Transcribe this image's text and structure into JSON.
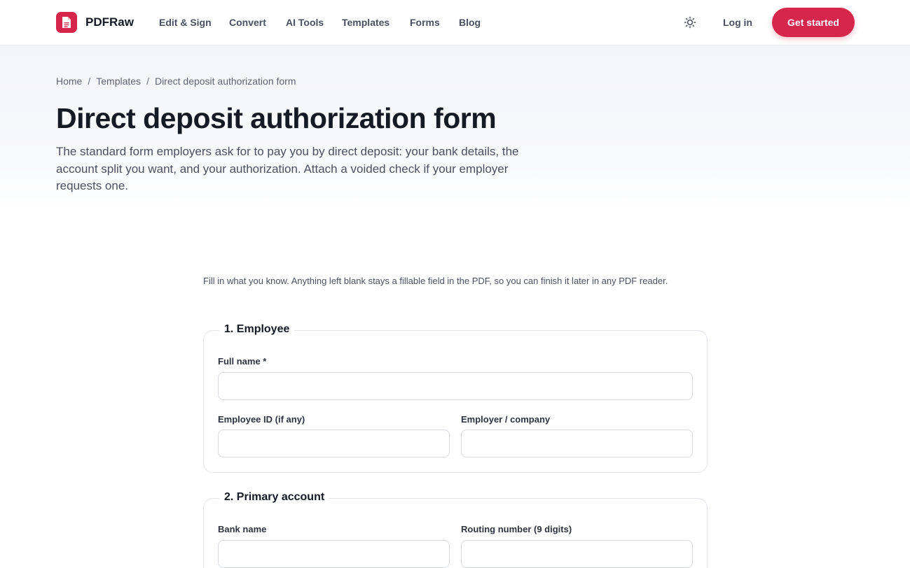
{
  "header": {
    "brand": "PDFRaw",
    "nav": [
      "Edit & Sign",
      "Convert",
      "AI Tools",
      "Templates",
      "Forms",
      "Blog"
    ],
    "login_label": "Log in",
    "cta_label": "Get started",
    "theme_icon": "sun-icon",
    "logo_icon": "document-icon"
  },
  "breadcrumb": {
    "items": [
      "Home",
      "Templates",
      "Direct deposit authorization form"
    ],
    "separator": "/"
  },
  "page": {
    "title": "Direct deposit authorization form",
    "lede": "The standard form employers ask for to pay you by direct deposit: your bank details, the account split you want, and your authorization. Attach a voided check if your employer requests one."
  },
  "form": {
    "intro": "Fill in what you know. Anything left blank stays a fillable field in the PDF, so you can finish it later in any PDF reader.",
    "sections": [
      {
        "legend": "1. Employee",
        "fields": [
          {
            "label": "Full name *",
            "value": ""
          },
          {
            "label": "Employee ID (if any)",
            "value": ""
          },
          {
            "label": "Employer / company",
            "value": ""
          }
        ]
      },
      {
        "legend": "2. Primary account",
        "fields": [
          {
            "label": "Bank name",
            "value": ""
          },
          {
            "label": "Routing number (9 digits)",
            "value": ""
          }
        ]
      }
    ]
  },
  "colors": {
    "accent": "#d7264c",
    "text": "#161a24",
    "muted": "#4b5060",
    "border": "#e3e5ea"
  }
}
